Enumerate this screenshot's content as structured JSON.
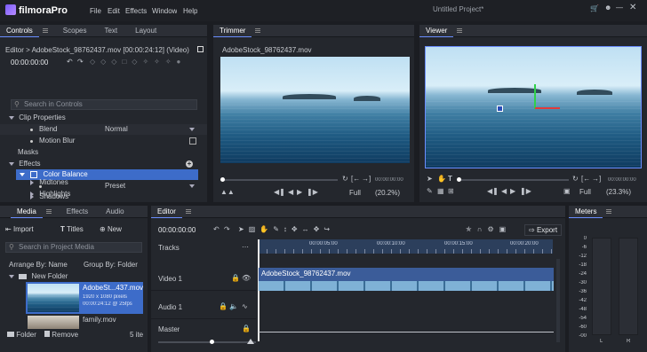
{
  "app": {
    "logo": "filmoraPro",
    "menu": [
      "File",
      "Edit",
      "Effects",
      "Window",
      "Help"
    ],
    "project_title": "Untitled Project*"
  },
  "controls": {
    "tabs": [
      "Controls",
      "Scopes",
      "Text",
      "Layout"
    ],
    "clip_title": "Editor > AdobeStock_98762437.mov [00:00:24:12] (Video)",
    "timecode": "00:00:00:00",
    "search_placeholder": "Search in Controls",
    "clip_properties": "Clip Properties",
    "blend_label": "Blend",
    "blend_value": "Normal",
    "motion_blur_label": "Motion Blur",
    "masks_label": "Masks",
    "effects_label": "Effects",
    "color_balance_label": "Color Balance",
    "preset_value": "Preset",
    "shadows_label": "Shadows",
    "midtones_label": "Midtones",
    "highlights_label": "Highlights"
  },
  "trimmer": {
    "tab": "Trimmer",
    "clip_name": "AdobeStock_98762437.mov",
    "timecode": "00:00:00:00",
    "quality": "Full",
    "zoom": "(20.2%)"
  },
  "viewer": {
    "tab": "Viewer",
    "timecode": "00:00:00:00",
    "quality": "Full",
    "zoom": "(23.3%)"
  },
  "media": {
    "tabs": [
      "Media",
      "Effects",
      "Audio"
    ],
    "import_label": "Import",
    "titles_label": "Titles",
    "new_label": "New",
    "search_placeholder": "Search in Project Media",
    "arrange_label": "Arrange By: Name",
    "group_label": "Group By: Folder",
    "folder_name": "New Folder",
    "item1_name": "AdobeSt...437.mov",
    "item1_res": "1920 x 1080 pixels",
    "item1_dur": "00:00:24:12 @ 25fps",
    "item2_name": "family.mov",
    "folder_btn": "Folder",
    "remove_btn": "Remove",
    "count": "5 ite"
  },
  "editor": {
    "tab": "Editor",
    "timecode": "00:00:00:00",
    "export_label": "Export",
    "ruler": [
      "00:00:05:00",
      "00:00:10:00",
      "00:00:15:00",
      "00:00:20:00"
    ],
    "tracks_label": "Tracks",
    "video_track": "Video 1",
    "audio_track": "Audio 1",
    "master_track": "Master",
    "clip_name": "AdobeStock_98762437.mov"
  },
  "meters": {
    "tab": "Meters",
    "scale": [
      "0",
      "-6",
      "-12",
      "-18",
      "-24",
      "-30",
      "-36",
      "-42",
      "-48",
      "-54",
      "-60",
      "-00"
    ],
    "channels": [
      "L",
      "R"
    ]
  },
  "colors": {
    "accent": "#3d6cc9",
    "bg": "#1b1d22",
    "panel": "#24272d"
  }
}
